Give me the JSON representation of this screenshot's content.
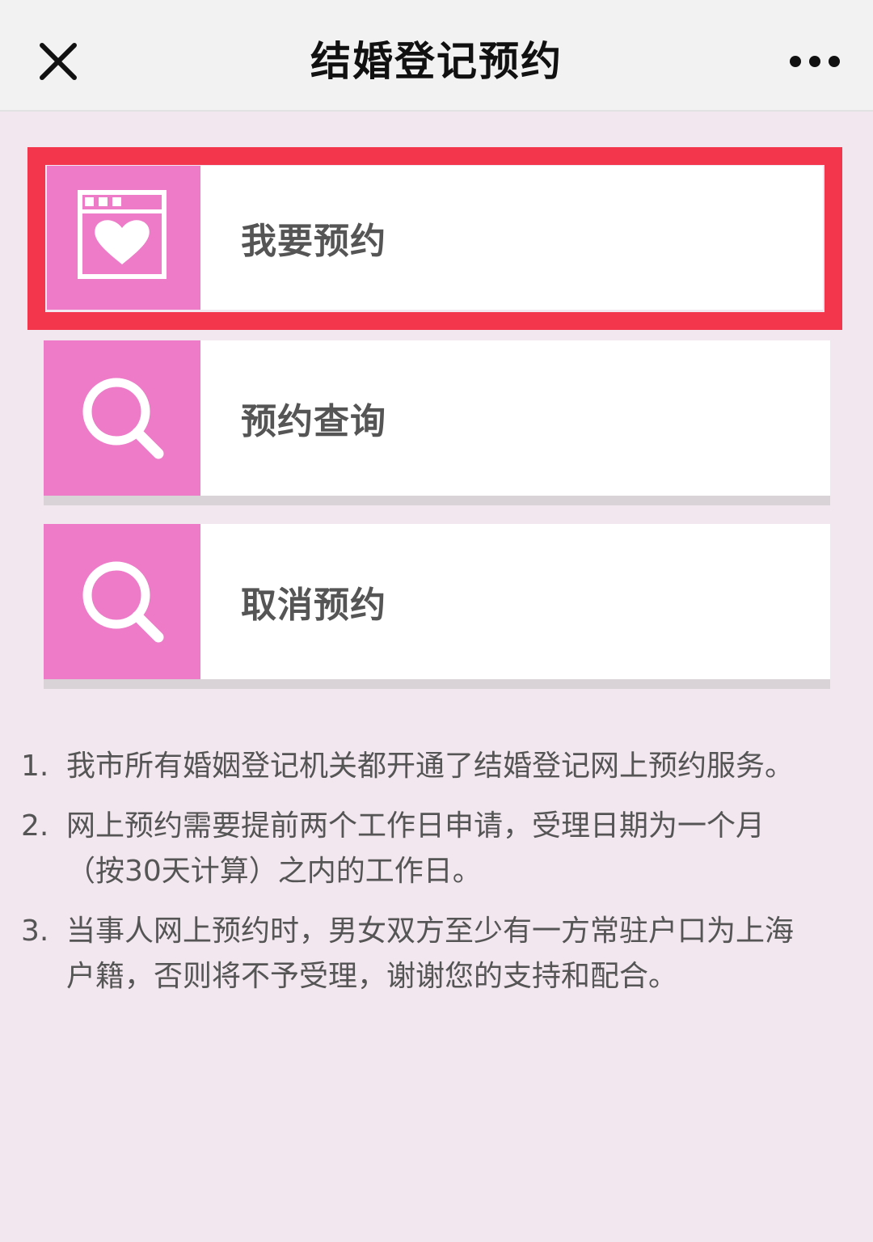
{
  "header": {
    "title": "结婚登记预约",
    "close_icon": "close-icon",
    "more_icon": "more-dots-icon"
  },
  "menu": [
    {
      "label": "我要预约",
      "icon": "calendar-heart-icon",
      "highlighted": true
    },
    {
      "label": "预约查询",
      "icon": "search-icon",
      "highlighted": false
    },
    {
      "label": "取消预约",
      "icon": "search-icon",
      "highlighted": false
    }
  ],
  "notes": [
    {
      "num": "1.",
      "text": "我市所有婚姻登记机关都开通了结婚登记网上预约服务。"
    },
    {
      "num": "2.",
      "text": "网上预约需要提前两个工作日申请，受理日期为一个月（按30天计算）之内的工作日。"
    },
    {
      "num": "3.",
      "text": "当事人网上预约时，男女双方至少有一方常驻户口为上海户籍，否则将不予受理，谢谢您的支持和配合。"
    }
  ],
  "colors": {
    "accent_pink": "#ee7bc8",
    "highlight_red": "#f4364c",
    "background": "#f2e7ee"
  }
}
